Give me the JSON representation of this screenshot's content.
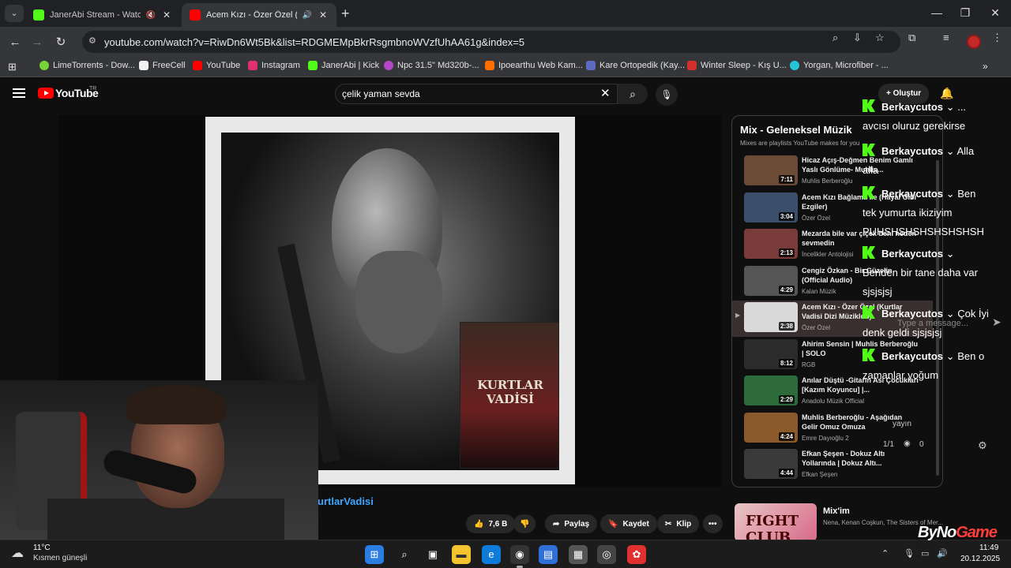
{
  "browser": {
    "tabs": [
      {
        "title": "JanerAbi Stream - Watch Live",
        "favicon_color": "#53fc18",
        "active": false
      },
      {
        "title": "Acem Kızı - Özer Özel (Kurtlar",
        "favicon_color": "#ff0000",
        "active": true
      }
    ],
    "url": "youtube.com/watch?v=RiwDn6Wt5Bk&list=RDGMEMpBkrRsgmbnoWVzfUhAA61g&index=5",
    "bookmarks": [
      {
        "label": "LimeTorrents - Dow...",
        "color": "#7bd33a"
      },
      {
        "label": "FreeCell",
        "color": "#f2f2f2"
      },
      {
        "label": "YouTube",
        "color": "#ff0000"
      },
      {
        "label": "Instagram",
        "color": "#e1306c"
      },
      {
        "label": "JanerAbi | Kick",
        "color": "#53fc18"
      },
      {
        "label": "Npc 31.5\" Md320b-...",
        "color": "#b548c6"
      },
      {
        "label": "Ipoearthu Web Kam...",
        "color": "#ff6f00"
      },
      {
        "label": "Kare Ortopedik (Kay...",
        "color": "#5c6bc0"
      },
      {
        "label": "Winter Sleep - Kış U...",
        "color": "#d32f2f"
      },
      {
        "label": "Yorgan, Microfiber - ...",
        "color": "#26c6da"
      }
    ]
  },
  "youtube": {
    "logo_text": "YouTube",
    "region": "TR",
    "search_query": "çelik yaman sevda",
    "create_label": "Oluştur",
    "video_title_fragment": "urtlarVadisi",
    "dvd_title": "KURTLAR VADİSİ",
    "actions": {
      "likes": "7,6 B",
      "share": "Paylaş",
      "save": "Kaydet",
      "clip": "Klip"
    },
    "playlist": {
      "title": "Mix - Geleneksel Müzik",
      "subtitle": "Mixes are playlists YouTube makes for you",
      "items": [
        {
          "title": "Hicaz Açış-Değmen Benim Gamlı Yaslı Gönlüme- Muhlis...",
          "channel": "Muhlis Berberoğlu",
          "duration": "7:11",
          "thumb_color": "#6b4a36",
          "current": false
        },
        {
          "title": "Acem Kızı Bağlama ile (Hayal Gibi Ezgiler)",
          "channel": "Özer Özel",
          "duration": "3:04",
          "thumb_color": "#3b4f6b",
          "current": false
        },
        {
          "title": "Mezarda bile var çiçek beni neden sevmedin",
          "channel": "İncelikler Antolojisi",
          "duration": "2:13",
          "thumb_color": "#7a3b3b",
          "current": false
        },
        {
          "title": "Cengiz Özkan - Bir Güzelin (Official Audio)",
          "channel": "Kalan Müzik",
          "duration": "4:29",
          "thumb_color": "#555555",
          "current": false
        },
        {
          "title": "Acem Kızı - Özer Özel (Kurtlar Vadisi Dizi Müzikleri)",
          "channel": "Özer Özel",
          "duration": "2:38",
          "thumb_color": "#d9d9d9",
          "current": true
        },
        {
          "title": "Ahirim Sensin | Muhlis Berberoğlu | SOLO",
          "channel": "RGB",
          "duration": "8:12",
          "thumb_color": "#2b2b2b",
          "current": false
        },
        {
          "title": "Anılar Düştü -Gitarın Asi Çocukları [Kazım Koyuncu] |...",
          "channel": "Anadolu Müzik Official",
          "duration": "2:29",
          "thumb_color": "#2e6b3a",
          "current": false
        },
        {
          "title": "Muhlis Berberoğlu - Aşağıdan Gelir Omuz Omuza",
          "channel": "Emre Dayıoğlu 2",
          "duration": "4:24",
          "thumb_color": "#8a5a2b",
          "current": false
        },
        {
          "title": "Efkan Şeşen - Dokuz Altı Yollarında | Dokuz Altı...",
          "channel": "Efkan Şeşen",
          "duration": "4:44",
          "thumb_color": "#3a3a3a",
          "current": false
        }
      ]
    },
    "mix_card": {
      "title": "Mix'im",
      "subtitle": "Nena, Kenan Coşkun, The Sisters of Mer...",
      "thumb_text": "FIGHT CLUB"
    }
  },
  "chat": {
    "messages": [
      {
        "user": "Berkaycutos",
        "text": "...",
        "continuation": "avcısı oluruz gerekirse"
      },
      {
        "user": "Berkaycutos",
        "text": "Alla",
        "continuation": "alla"
      },
      {
        "user": "Berkaycutos",
        "text": "Ben",
        "continuation": "tek yumurta ikiziyim PUHSHSHSHSHSHSHSH"
      },
      {
        "user": "Berkaycutos",
        "text": "",
        "continuation": "Benden bir tane daha var sjsjsjsj"
      },
      {
        "user": "Berkaycutos",
        "text": "Çok İyi",
        "continuation": "denk geldi sjsjsjsj"
      },
      {
        "user": "Berkaycutos",
        "text": "Ben o",
        "continuation": "zamanlar yoğum"
      }
    ],
    "input_placeholder": "Type a message...",
    "status_text": "yayın",
    "viewer_fraction": "1/1",
    "viewers": "0"
  },
  "taskbar": {
    "temperature": "11°C",
    "weather": "Kısmen güneşli",
    "time": "11:49",
    "date": "20.12.2025"
  },
  "watermark": {
    "left": "ByNo",
    "right": "Game"
  }
}
